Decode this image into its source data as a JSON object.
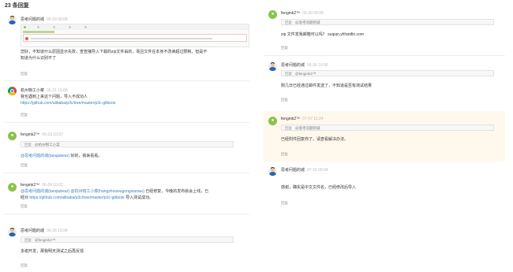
{
  "header": {
    "title": "23 条回复"
  },
  "left": [
    {
      "author": "思考问题的城",
      "time": "06-09 08:08",
      "text_lines": [
        "您好，不知道什么原因显示失败，查查播导入下载的zip文件由的，而且文件在本身不改读超过限制，但是不",
        "知道为什么识别不了"
      ],
      "reply": "回复"
    },
    {
      "author": "杭州物工小菜",
      "time": "06-21 15:08",
      "text_lines": [
        "我也遇到上来这个问题，导入不成功人"
      ],
      "link": "https://github.com/alibaba/p3c/tree/master/p3c-gitbook",
      "reply": "回复"
    },
    {
      "author": "fengmk2™",
      "time": "06-23 10:07",
      "quote_label": "回复",
      "quote": "@杭州物工小菜",
      "mention": "@思考问题的城(taoqiubear)",
      "text_after": " 好的，我来看看。",
      "reply": "回复"
    },
    {
      "author": "fengmk2™",
      "time": "06-28 10:02",
      "mention": "@思考问题的城(taoqiubear) @杭州物工小菜(hangzhouwugongxiaowu)",
      "text_after": " 已经修复，今晚的发布就会上线，已",
      "line2_prefix": "经对 ",
      "link": "https://github.com/alibaba/p3c/tree/master/p3c-gitbook",
      "line2_suffix": " 导入测试成功。",
      "reply": "回复"
    },
    {
      "author": "思考问题的城",
      "time": "06-28 10:34",
      "quote_label": "回复",
      "quote": "@fengmk2™",
      "text_lines": [
        "多谢开发，那我明天测试之后再反馈"
      ],
      "reply": "回复"
    }
  ],
  "right": [
    {
      "author": "fengmk2™",
      "time": "06-30 09:08",
      "quote_label": "回复",
      "quote": "@思考问题的城",
      "text_lines": [
        "zip 文件发我邮箱可以吗？ suqian.yf#antfin.com"
      ],
      "reply": "回复"
    },
    {
      "author": "思考问题的城",
      "time": "06-30 16:06",
      "quote_label": "回复",
      "quote": "@fengmk2™",
      "text_lines": [
        "刚几日已经通过邮件发送了，不知道是否有测试结果"
      ],
      "reply": "回复"
    },
    {
      "author": "fengmk2™",
      "time": "07-07 11:24",
      "quote_label": "回复",
      "quote": "@思考问题的城",
      "text_lines": [
        "已经附件回复你了，请查看解决办法。"
      ],
      "reply": "回复"
    },
    {
      "author": "思考问题的城",
      "time": "07-10 09:34",
      "text_lines": [
        "感谢，确实是中文文件名，已经修改后导入"
      ],
      "reply": "回复"
    }
  ],
  "screenshot_caption": "导入失败截图",
  "colors": {
    "accent": "#3b7fc4",
    "highlight_bg": "#fff8ec",
    "muted": "#999999"
  }
}
